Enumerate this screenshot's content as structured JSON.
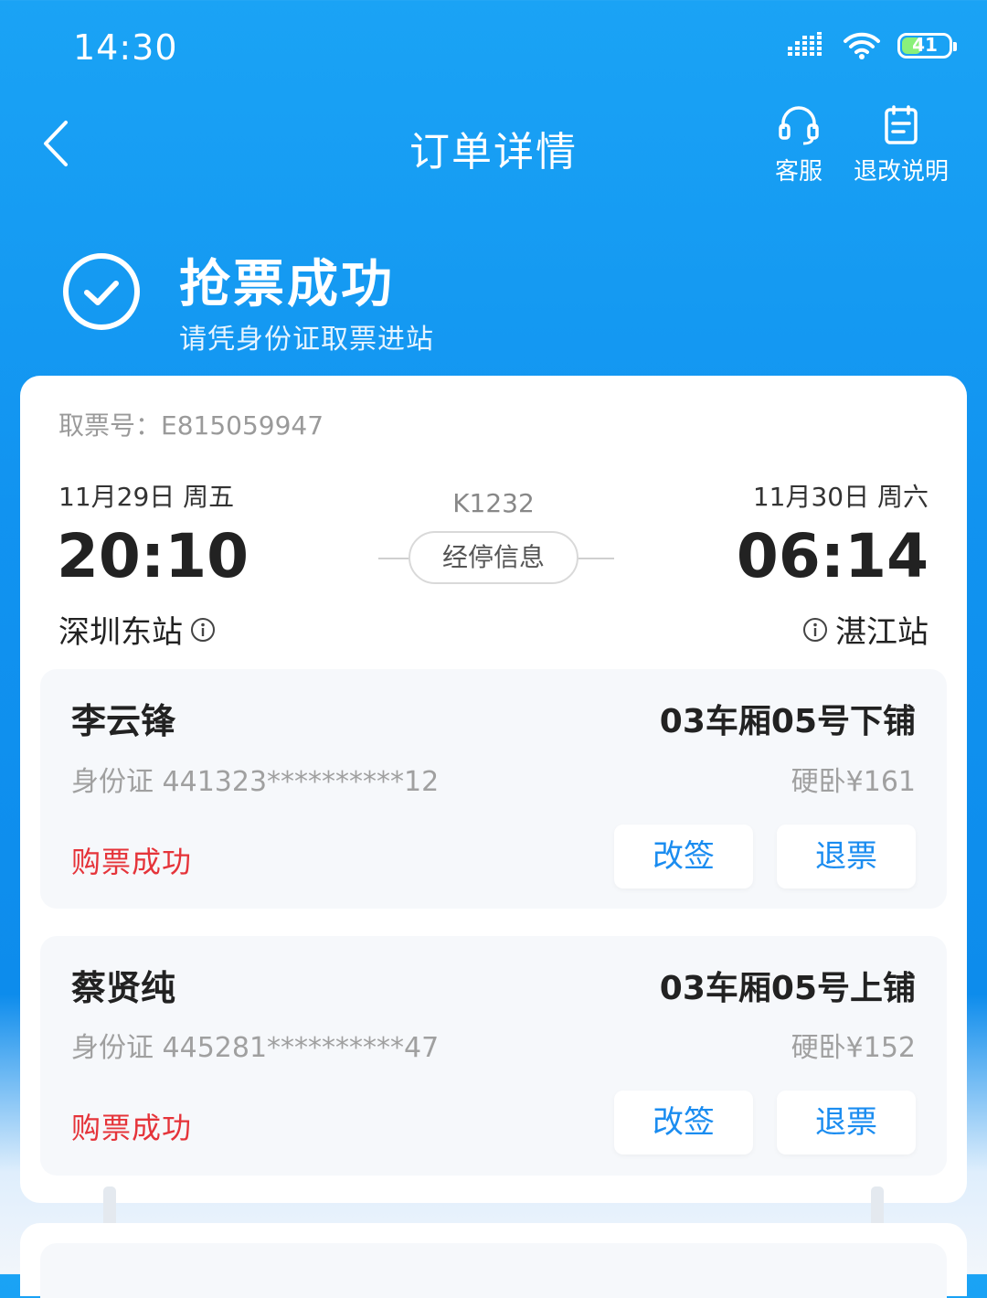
{
  "status_bar": {
    "time": "14:30",
    "battery": "41",
    "battery_level": 0.41
  },
  "header": {
    "title": "订单详情",
    "service_label": "客服",
    "refund_rules_label": "退改说明"
  },
  "banner": {
    "title": "抢票成功",
    "subtitle": "请凭身份证取票进站"
  },
  "order": {
    "pickup_no": "取票号：E815059947",
    "departure": {
      "date": "11月29日  周五",
      "time": "20:10",
      "station": "深圳东站"
    },
    "arrival": {
      "date": "11月30日  周六",
      "time": "06:14",
      "station": "湛江站"
    },
    "train_no": "K1232",
    "stops_label": "经停信息"
  },
  "passengers": [
    {
      "name": "李云锋",
      "seat": "03车厢05号下铺",
      "id": "身份证 441323**********12",
      "price": "硬卧¥161",
      "status": "购票成功",
      "change_label": "改签",
      "refund_label": "退票"
    },
    {
      "name": "蔡贤纯",
      "seat": "03车厢05号上铺",
      "id": "身份证 445281**********47",
      "price": "硬卧¥152",
      "status": "购票成功",
      "change_label": "改签",
      "refund_label": "退票"
    }
  ],
  "colors": {
    "primary": "#1193f0",
    "status_success": "#e5343a",
    "action_text": "#1a8cf0"
  }
}
